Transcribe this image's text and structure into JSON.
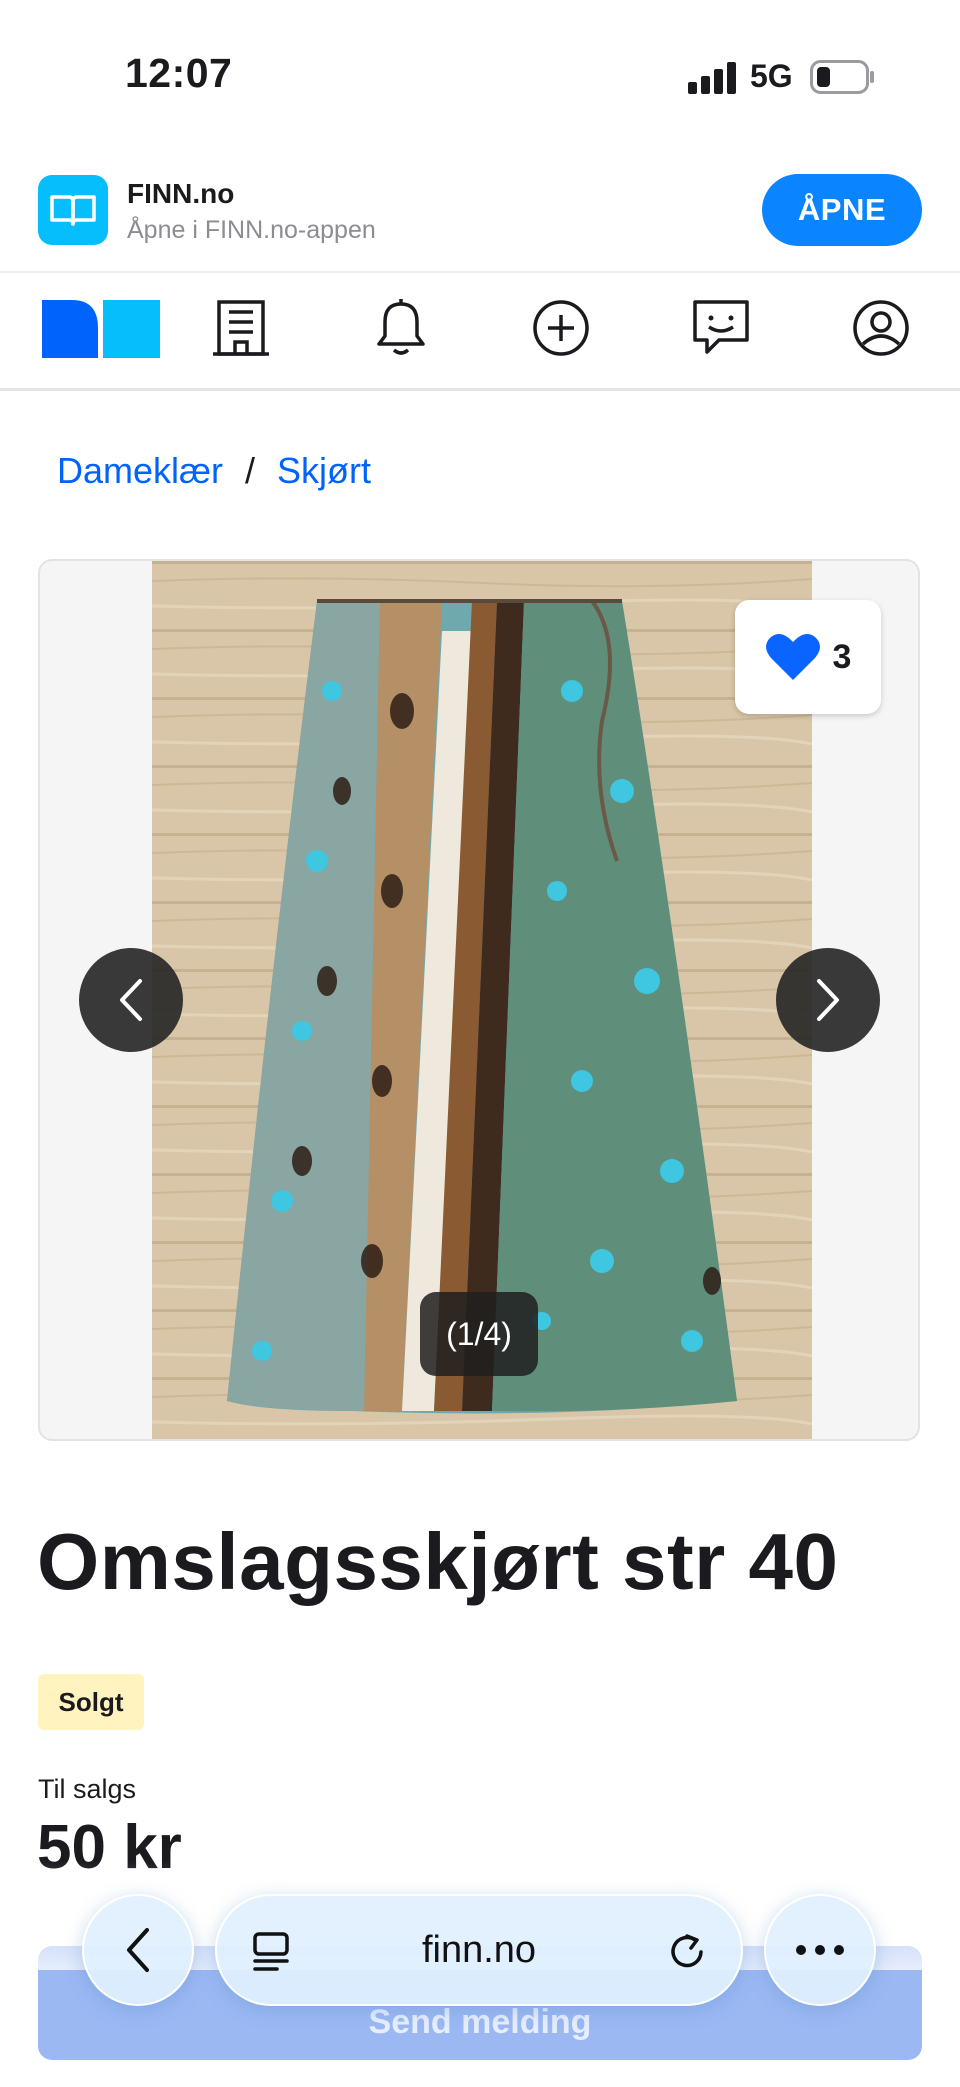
{
  "status_bar": {
    "time": "12:07",
    "network": "5G"
  },
  "app_banner": {
    "app_name": "FINN.no",
    "subtitle": "Åpne i FINN.no-appen",
    "open_label": "ÅPNE"
  },
  "nav": {
    "icons": [
      "finn-logo",
      "building-icon",
      "bell-icon",
      "plus-circle-icon",
      "chat-icon",
      "profile-icon"
    ]
  },
  "breadcrumb": {
    "items": [
      "Dameklær",
      "Skjørt"
    ],
    "separator": "/"
  },
  "gallery": {
    "favorites_count": "3",
    "counter": "(1/4)"
  },
  "listing": {
    "title": "Omslagsskjørt str 40",
    "status_badge": "Solgt",
    "price_label": "Til salgs",
    "price": "50 kr",
    "contact_button": "Send melding"
  },
  "browser": {
    "url": "finn.no"
  },
  "colors": {
    "finn_blue": "#0063fb",
    "finn_light_blue": "#06befb",
    "ios_blue": "#0a84ff",
    "sold_badge_bg": "#fff4bf"
  }
}
